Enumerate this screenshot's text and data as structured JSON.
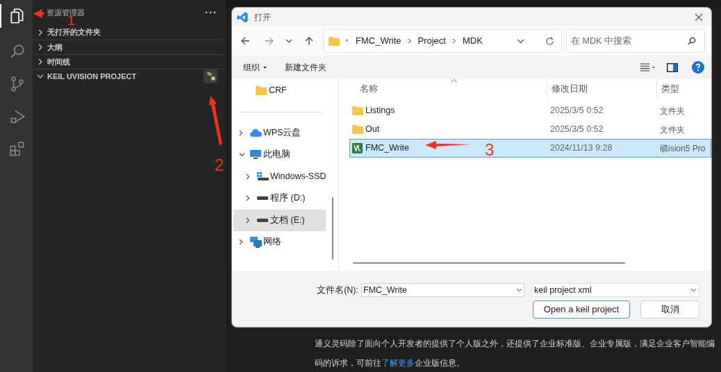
{
  "activity_bar": [
    {
      "kind": "files",
      "selected": true
    },
    {
      "kind": "search",
      "selected": false
    },
    {
      "kind": "source-control",
      "selected": false
    },
    {
      "kind": "run-debug",
      "selected": false
    },
    {
      "kind": "extensions",
      "selected": false
    }
  ],
  "sidebar": {
    "title": "资源管理器",
    "sections": [
      {
        "label": "无打开的文件夹",
        "expanded": false,
        "action": false
      },
      {
        "label": "大纲",
        "expanded": false,
        "action": false
      },
      {
        "label": "时间线",
        "expanded": false,
        "action": false
      },
      {
        "label": "KEIL UVISION PROJECT",
        "expanded": true,
        "action": true
      }
    ]
  },
  "dialog": {
    "title": "打开",
    "overflow": "«",
    "breadcrumb": [
      "FMC_Write",
      "Project",
      "MDK"
    ],
    "search": {
      "placeholder": "在 MDK 中搜索"
    },
    "toolbar": [
      {
        "label": "组织",
        "menu": true
      },
      {
        "label": "新建文件夹",
        "menu": false
      }
    ],
    "nav": [
      {
        "label": "CRF",
        "kind": "folder",
        "selected": false
      },
      {
        "label": "WPS云盘",
        "kind": "cloud",
        "expanded": false,
        "selected": false
      },
      {
        "label": "此电脑",
        "kind": "pc",
        "expanded": true,
        "selected": false,
        "children": [
          {
            "label": "Windows-SSD",
            "kind": "system-drive",
            "expanded": false,
            "selected": false
          },
          {
            "label": "程序 (D:)",
            "kind": "drive",
            "expanded": false,
            "selected": false
          },
          {
            "label": "文档 (E:)",
            "kind": "drive",
            "expanded": false,
            "selected": true
          }
        ]
      },
      {
        "label": "网络",
        "kind": "network",
        "expanded": false,
        "selected": false
      }
    ],
    "columns": [
      "名称",
      "修改日期",
      "类型"
    ],
    "rows": [
      {
        "kind": "folder",
        "name": "Listings",
        "modified": "2025/3/5 0:52",
        "type": "文件夹",
        "selected": false
      },
      {
        "kind": "folder",
        "name": "Out",
        "modified": "2025/3/5 0:52",
        "type": "文件夹",
        "selected": false
      },
      {
        "kind": "project",
        "name": "FMC_Write",
        "modified": "2024/11/13 9:28",
        "type": "礦ision5 Pro",
        "selected": true
      }
    ],
    "file_name_label": "文件名(N):",
    "file_name": "FMC_Write",
    "file_type": "keil project xml",
    "buttons": [
      {
        "label": "Open a keil project",
        "kind": "primary"
      },
      {
        "label": "取消",
        "kind": "secondary"
      }
    ]
  },
  "article": {
    "before": "通义灵码除了面向个人开发者的提供了个人版之外，还提供了企业标准版、企业专属版，满足企业客户智能编码的诉求，可前往",
    "link": "了解更多",
    "after": "企业版信息。"
  },
  "annotations": [
    "1",
    "2",
    "3"
  ]
}
